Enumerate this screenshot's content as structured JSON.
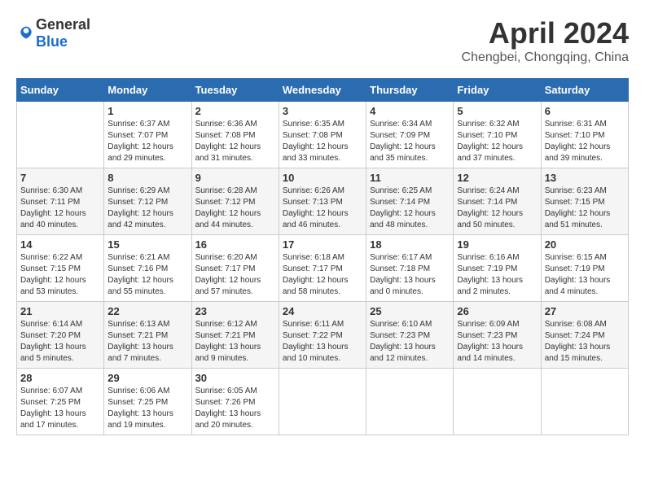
{
  "header": {
    "logo_general": "General",
    "logo_blue": "Blue",
    "month_year": "April 2024",
    "location": "Chengbei, Chongqing, China"
  },
  "calendar": {
    "days_of_week": [
      "Sunday",
      "Monday",
      "Tuesday",
      "Wednesday",
      "Thursday",
      "Friday",
      "Saturday"
    ],
    "weeks": [
      [
        {
          "day": "",
          "sunrise": "",
          "sunset": "",
          "daylight": ""
        },
        {
          "day": "1",
          "sunrise": "Sunrise: 6:37 AM",
          "sunset": "Sunset: 7:07 PM",
          "daylight": "Daylight: 12 hours and 29 minutes."
        },
        {
          "day": "2",
          "sunrise": "Sunrise: 6:36 AM",
          "sunset": "Sunset: 7:08 PM",
          "daylight": "Daylight: 12 hours and 31 minutes."
        },
        {
          "day": "3",
          "sunrise": "Sunrise: 6:35 AM",
          "sunset": "Sunset: 7:08 PM",
          "daylight": "Daylight: 12 hours and 33 minutes."
        },
        {
          "day": "4",
          "sunrise": "Sunrise: 6:34 AM",
          "sunset": "Sunset: 7:09 PM",
          "daylight": "Daylight: 12 hours and 35 minutes."
        },
        {
          "day": "5",
          "sunrise": "Sunrise: 6:32 AM",
          "sunset": "Sunset: 7:10 PM",
          "daylight": "Daylight: 12 hours and 37 minutes."
        },
        {
          "day": "6",
          "sunrise": "Sunrise: 6:31 AM",
          "sunset": "Sunset: 7:10 PM",
          "daylight": "Daylight: 12 hours and 39 minutes."
        }
      ],
      [
        {
          "day": "7",
          "sunrise": "Sunrise: 6:30 AM",
          "sunset": "Sunset: 7:11 PM",
          "daylight": "Daylight: 12 hours and 40 minutes."
        },
        {
          "day": "8",
          "sunrise": "Sunrise: 6:29 AM",
          "sunset": "Sunset: 7:12 PM",
          "daylight": "Daylight: 12 hours and 42 minutes."
        },
        {
          "day": "9",
          "sunrise": "Sunrise: 6:28 AM",
          "sunset": "Sunset: 7:12 PM",
          "daylight": "Daylight: 12 hours and 44 minutes."
        },
        {
          "day": "10",
          "sunrise": "Sunrise: 6:26 AM",
          "sunset": "Sunset: 7:13 PM",
          "daylight": "Daylight: 12 hours and 46 minutes."
        },
        {
          "day": "11",
          "sunrise": "Sunrise: 6:25 AM",
          "sunset": "Sunset: 7:14 PM",
          "daylight": "Daylight: 12 hours and 48 minutes."
        },
        {
          "day": "12",
          "sunrise": "Sunrise: 6:24 AM",
          "sunset": "Sunset: 7:14 PM",
          "daylight": "Daylight: 12 hours and 50 minutes."
        },
        {
          "day": "13",
          "sunrise": "Sunrise: 6:23 AM",
          "sunset": "Sunset: 7:15 PM",
          "daylight": "Daylight: 12 hours and 51 minutes."
        }
      ],
      [
        {
          "day": "14",
          "sunrise": "Sunrise: 6:22 AM",
          "sunset": "Sunset: 7:15 PM",
          "daylight": "Daylight: 12 hours and 53 minutes."
        },
        {
          "day": "15",
          "sunrise": "Sunrise: 6:21 AM",
          "sunset": "Sunset: 7:16 PM",
          "daylight": "Daylight: 12 hours and 55 minutes."
        },
        {
          "day": "16",
          "sunrise": "Sunrise: 6:20 AM",
          "sunset": "Sunset: 7:17 PM",
          "daylight": "Daylight: 12 hours and 57 minutes."
        },
        {
          "day": "17",
          "sunrise": "Sunrise: 6:18 AM",
          "sunset": "Sunset: 7:17 PM",
          "daylight": "Daylight: 12 hours and 58 minutes."
        },
        {
          "day": "18",
          "sunrise": "Sunrise: 6:17 AM",
          "sunset": "Sunset: 7:18 PM",
          "daylight": "Daylight: 13 hours and 0 minutes."
        },
        {
          "day": "19",
          "sunrise": "Sunrise: 6:16 AM",
          "sunset": "Sunset: 7:19 PM",
          "daylight": "Daylight: 13 hours and 2 minutes."
        },
        {
          "day": "20",
          "sunrise": "Sunrise: 6:15 AM",
          "sunset": "Sunset: 7:19 PM",
          "daylight": "Daylight: 13 hours and 4 minutes."
        }
      ],
      [
        {
          "day": "21",
          "sunrise": "Sunrise: 6:14 AM",
          "sunset": "Sunset: 7:20 PM",
          "daylight": "Daylight: 13 hours and 5 minutes."
        },
        {
          "day": "22",
          "sunrise": "Sunrise: 6:13 AM",
          "sunset": "Sunset: 7:21 PM",
          "daylight": "Daylight: 13 hours and 7 minutes."
        },
        {
          "day": "23",
          "sunrise": "Sunrise: 6:12 AM",
          "sunset": "Sunset: 7:21 PM",
          "daylight": "Daylight: 13 hours and 9 minutes."
        },
        {
          "day": "24",
          "sunrise": "Sunrise: 6:11 AM",
          "sunset": "Sunset: 7:22 PM",
          "daylight": "Daylight: 13 hours and 10 minutes."
        },
        {
          "day": "25",
          "sunrise": "Sunrise: 6:10 AM",
          "sunset": "Sunset: 7:23 PM",
          "daylight": "Daylight: 13 hours and 12 minutes."
        },
        {
          "day": "26",
          "sunrise": "Sunrise: 6:09 AM",
          "sunset": "Sunset: 7:23 PM",
          "daylight": "Daylight: 13 hours and 14 minutes."
        },
        {
          "day": "27",
          "sunrise": "Sunrise: 6:08 AM",
          "sunset": "Sunset: 7:24 PM",
          "daylight": "Daylight: 13 hours and 15 minutes."
        }
      ],
      [
        {
          "day": "28",
          "sunrise": "Sunrise: 6:07 AM",
          "sunset": "Sunset: 7:25 PM",
          "daylight": "Daylight: 13 hours and 17 minutes."
        },
        {
          "day": "29",
          "sunrise": "Sunrise: 6:06 AM",
          "sunset": "Sunset: 7:25 PM",
          "daylight": "Daylight: 13 hours and 19 minutes."
        },
        {
          "day": "30",
          "sunrise": "Sunrise: 6:05 AM",
          "sunset": "Sunset: 7:26 PM",
          "daylight": "Daylight: 13 hours and 20 minutes."
        },
        {
          "day": "",
          "sunrise": "",
          "sunset": "",
          "daylight": ""
        },
        {
          "day": "",
          "sunrise": "",
          "sunset": "",
          "daylight": ""
        },
        {
          "day": "",
          "sunrise": "",
          "sunset": "",
          "daylight": ""
        },
        {
          "day": "",
          "sunrise": "",
          "sunset": "",
          "daylight": ""
        }
      ]
    ]
  }
}
